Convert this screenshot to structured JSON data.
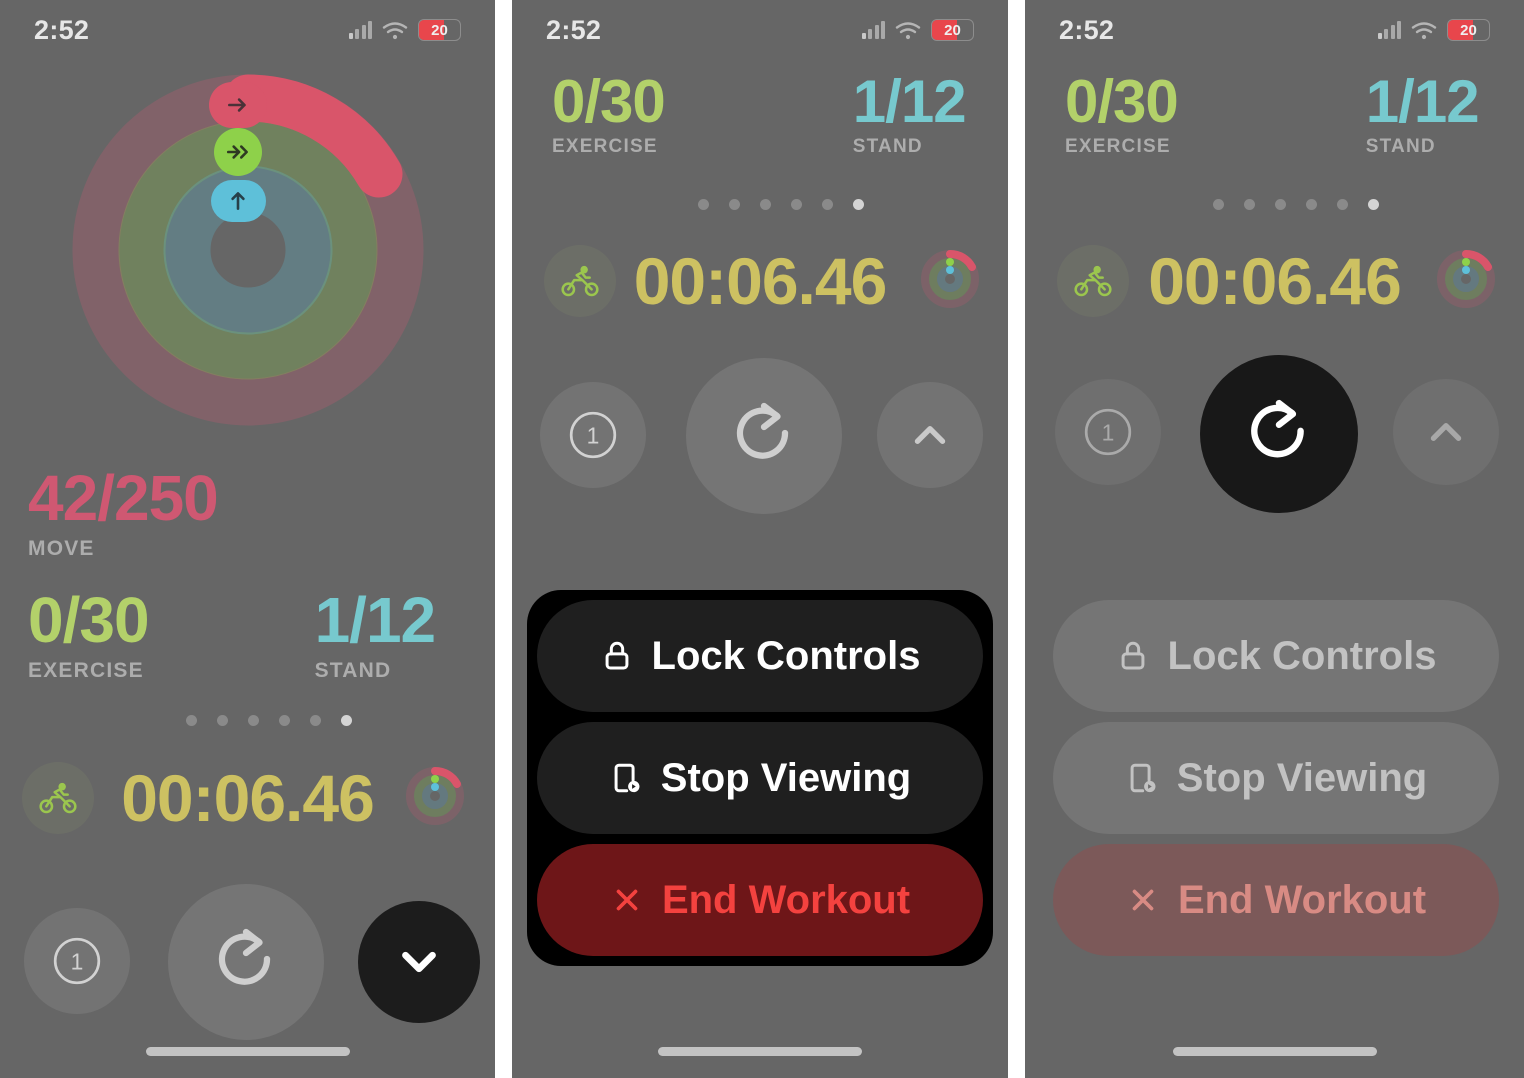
{
  "status_bar": {
    "time": "2:52",
    "battery_percent": "20",
    "wifi_icon": "wifi-icon",
    "cellular_icon": "cellular-signal-icon",
    "battery_icon": "battery-low-icon"
  },
  "colors": {
    "move": "#cf5872",
    "exercise": "#b3d16a",
    "stand": "#77c9ce",
    "timer": "#cdc162",
    "danger": "#f4423f",
    "battery_low": "#e8464c",
    "screen_bg": "#666666",
    "menu_bg": "#000000",
    "menu_item_bg": "#1f1f1f",
    "dark_button": "#1c1c1c"
  },
  "rings": {
    "move_ring_color": "#d9556a",
    "exercise_ring_color": "#8ed14a",
    "stand_ring_color": "#5ec0d9",
    "move_icon": "arrow-right-icon",
    "exercise_icon": "double-chevron-right-icon",
    "stand_icon": "arrow-up-icon"
  },
  "activity": {
    "move": {
      "value": "42/250",
      "label": "MOVE"
    },
    "exercise": {
      "value": "0/30",
      "label": "EXERCISE"
    },
    "stand": {
      "value": "1/12",
      "label": "STAND"
    }
  },
  "pager": {
    "total": 6,
    "active_index": 5
  },
  "workout": {
    "type_icon": "cycling-icon",
    "elapsed_time": "00:06.46",
    "rings_icon": "activity-rings-icon"
  },
  "controls": {
    "segment": {
      "label": "1",
      "icon": "segment-counter-icon"
    },
    "restart": {
      "icon": "restart-arrow-icon"
    },
    "expand_up": {
      "icon": "chevron-up-icon"
    },
    "collapse_down": {
      "icon": "chevron-down-icon"
    }
  },
  "action_menu": {
    "items": [
      {
        "label": "Lock Controls",
        "icon": "lock-icon",
        "style": "normal"
      },
      {
        "label": "Stop Viewing",
        "icon": "phone-stop-viewing-icon",
        "style": "normal"
      },
      {
        "label": "End Workout",
        "icon": "close-x-icon",
        "style": "danger"
      }
    ]
  },
  "home_indicator": "home-indicator"
}
